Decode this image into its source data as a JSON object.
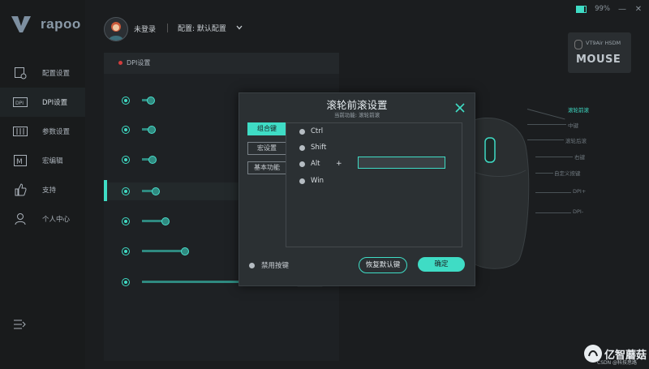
{
  "brand": {
    "logo_text": "rapoo",
    "accent": "#3fdcc5"
  },
  "sidebar": {
    "items": [
      {
        "label": "配置设置",
        "icon": "config-icon"
      },
      {
        "label": "DPI设置",
        "icon": "dpi-icon",
        "active": true
      },
      {
        "label": "参数设置",
        "icon": "params-icon"
      },
      {
        "label": "宏编辑",
        "icon": "macro-icon"
      },
      {
        "label": "支持",
        "icon": "thumbs-up-icon"
      },
      {
        "label": "个人中心",
        "icon": "user-icon"
      }
    ],
    "menu_icon": "menu-icon"
  },
  "topbar": {
    "login_text": "未登录",
    "config_text": "配置: 默认配置"
  },
  "window": {
    "battery": "99%",
    "minimize": "—",
    "close": "✕"
  },
  "device": {
    "name": "VT9Air HSDM",
    "type": "MOUSE"
  },
  "dpi_panel": {
    "title": "DPI设置",
    "levels": [
      {
        "level": 1,
        "ghost": ""
      },
      {
        "level": 2,
        "ghost": ""
      },
      {
        "level": 3,
        "ghost": ""
      },
      {
        "level": 4,
        "ghost": "",
        "selected": true
      },
      {
        "level": 5,
        "ghost": ""
      },
      {
        "level": 6,
        "ghost": ""
      },
      {
        "level": 7,
        "ghost": ""
      }
    ]
  },
  "callouts": [
    "滚轮前滚",
    "中键",
    "滚轮后滚",
    "右键",
    "自定义按键",
    "DPI+",
    "DPI-"
  ],
  "modal": {
    "title": "滚轮前滚设置",
    "subtitle": "当前功能: 滚轮前滚",
    "tabs": [
      "组合键",
      "宏设置",
      "基本功能"
    ],
    "modifiers": [
      "Ctrl",
      "Shift",
      "Alt",
      "Win"
    ],
    "plus": "+",
    "key_value": "",
    "disable_label": "禁用按键",
    "reset_label": "恢复默认键",
    "ok_label": "确定"
  },
  "watermark": {
    "text": "亿智蘑菇",
    "sub": "CSDN @科技思路"
  }
}
